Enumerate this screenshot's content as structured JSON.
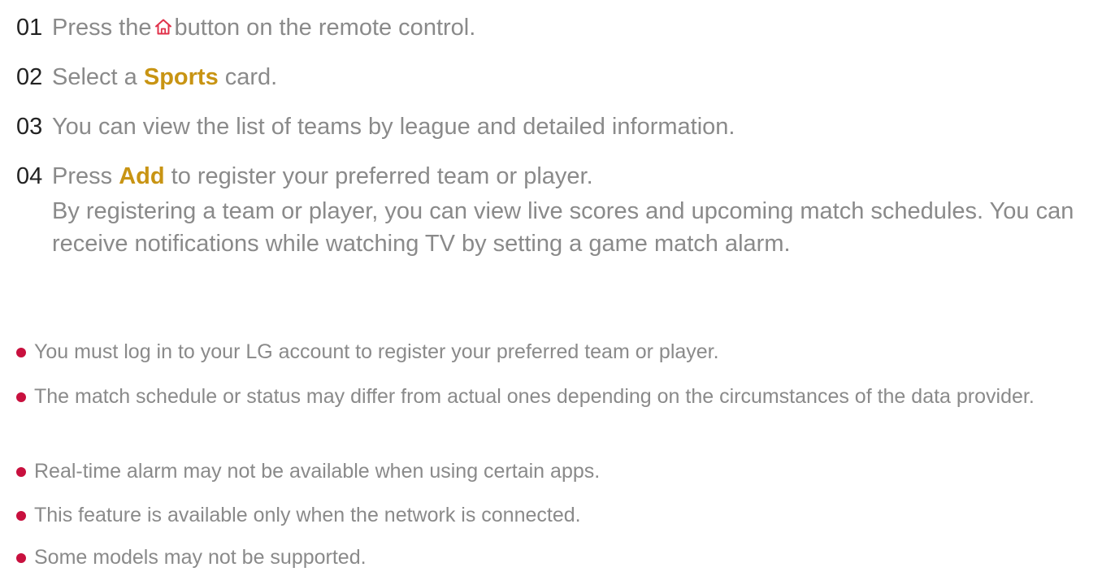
{
  "steps": [
    {
      "num": "01",
      "before": "Press the",
      "after": "button on the remote control.",
      "icon": "home-icon"
    },
    {
      "num": "02",
      "before": "Select a",
      "highlight": "Sports",
      "after": "card."
    },
    {
      "num": "03",
      "text": "You can view the list of teams by league and detailed information."
    },
    {
      "num": "04",
      "before": "Press",
      "highlight": "Add",
      "after": "to register your preferred team or player.",
      "extra": "By registering a team or player, you can view live scores and upcoming match schedules. You can receive notifications while watching TV by setting a game match alarm."
    }
  ],
  "notes": [
    "You must log in to your LG account to register your preferred team or player.",
    "The match schedule or status may differ from actual ones depending on the circumstances of the data provider.",
    "Real-time alarm may not be available when using certain apps.",
    "This feature is available only when the network is connected.",
    "Some models may not be supported."
  ],
  "colors": {
    "highlight": "#c89413",
    "bullet": "#c8103e",
    "body_text": "#8a8a8a",
    "step_number": "#222222",
    "icon": "#e0314a"
  }
}
